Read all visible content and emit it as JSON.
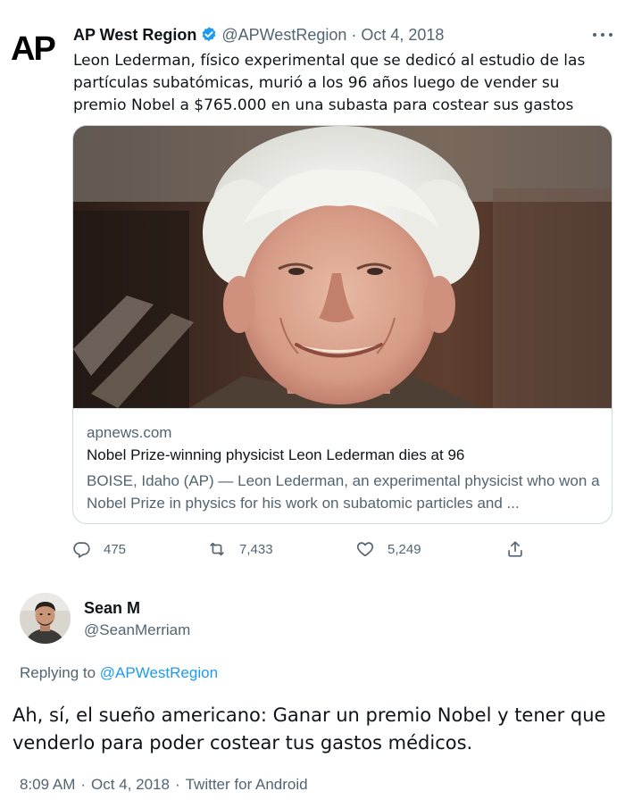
{
  "quoted_tweet": {
    "logo_text": "AP",
    "author_name": "AP West Region",
    "verified": true,
    "handle": "@APWestRegion",
    "separator": "·",
    "date": "Oct 4, 2018",
    "text": "Leon Lederman, físico experimental que se dedicó al estudio de las partículas subatómicas, murió a los 96 años luego de vender su premio Nobel a $765.000 en una subasta para costear sus gastos",
    "card": {
      "domain": "apnews.com",
      "title": "Nobel Prize-winning physicist Leon Lederman dies at 96",
      "description": "BOISE, Idaho (AP) — Leon Lederman, an experimental physicist who won a Nobel Prize in physics for his work on subatomic particles and ..."
    },
    "actions": {
      "replies": "475",
      "retweets": "7,433",
      "likes": "5,249"
    }
  },
  "tweet": {
    "author_name": "Sean M",
    "handle": "@SeanMerriam",
    "replying_prefix": "Replying to",
    "replying_to": "@APWestRegion",
    "text": "Ah, sí, el sueño americano: Ganar un premio Nobel y tener que venderlo para poder costear tus gastos médicos.",
    "time": "8:09 AM",
    "separator": "·",
    "date": "Oct 4, 2018",
    "client": "Twitter for Android"
  },
  "colors": {
    "text": "#0f1419",
    "secondary": "#536471",
    "accent": "#1d9bf0",
    "border": "#cfd9de"
  },
  "icons": [
    "ap-logo",
    "verified-badge-icon",
    "more-options-icon",
    "reply-icon",
    "retweet-icon",
    "like-icon",
    "share-icon"
  ]
}
